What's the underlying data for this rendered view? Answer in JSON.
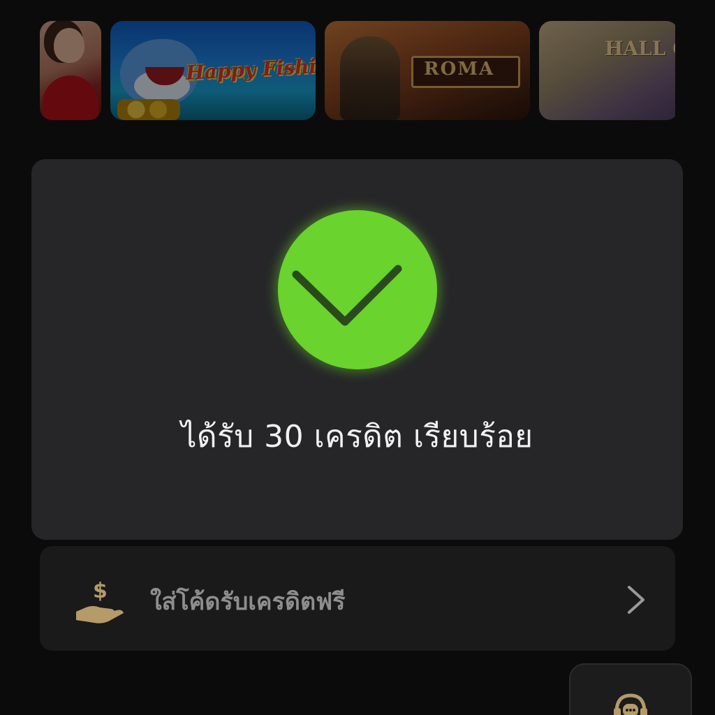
{
  "games": [
    {
      "name": "portrait-game",
      "title": ""
    },
    {
      "name": "happy-fishing",
      "title": "Happy Fishing"
    },
    {
      "name": "roma",
      "title": "ROMA"
    },
    {
      "name": "hall-of-gods",
      "title": "HALL OF GODS"
    }
  ],
  "success": {
    "icon": "check-icon",
    "message": "ได้รับ 30 เครดิต เรียบร้อย",
    "accent_color": "#6ad32e"
  },
  "promo": {
    "icon": "hand-money-icon",
    "label": "ใส่โค้ดรับเครดิตฟรี",
    "chevron": "chevron-right-icon",
    "icon_color": "#b59a6a"
  },
  "support": {
    "icon": "headset-chat-icon",
    "icon_color": "#b59a6a"
  }
}
